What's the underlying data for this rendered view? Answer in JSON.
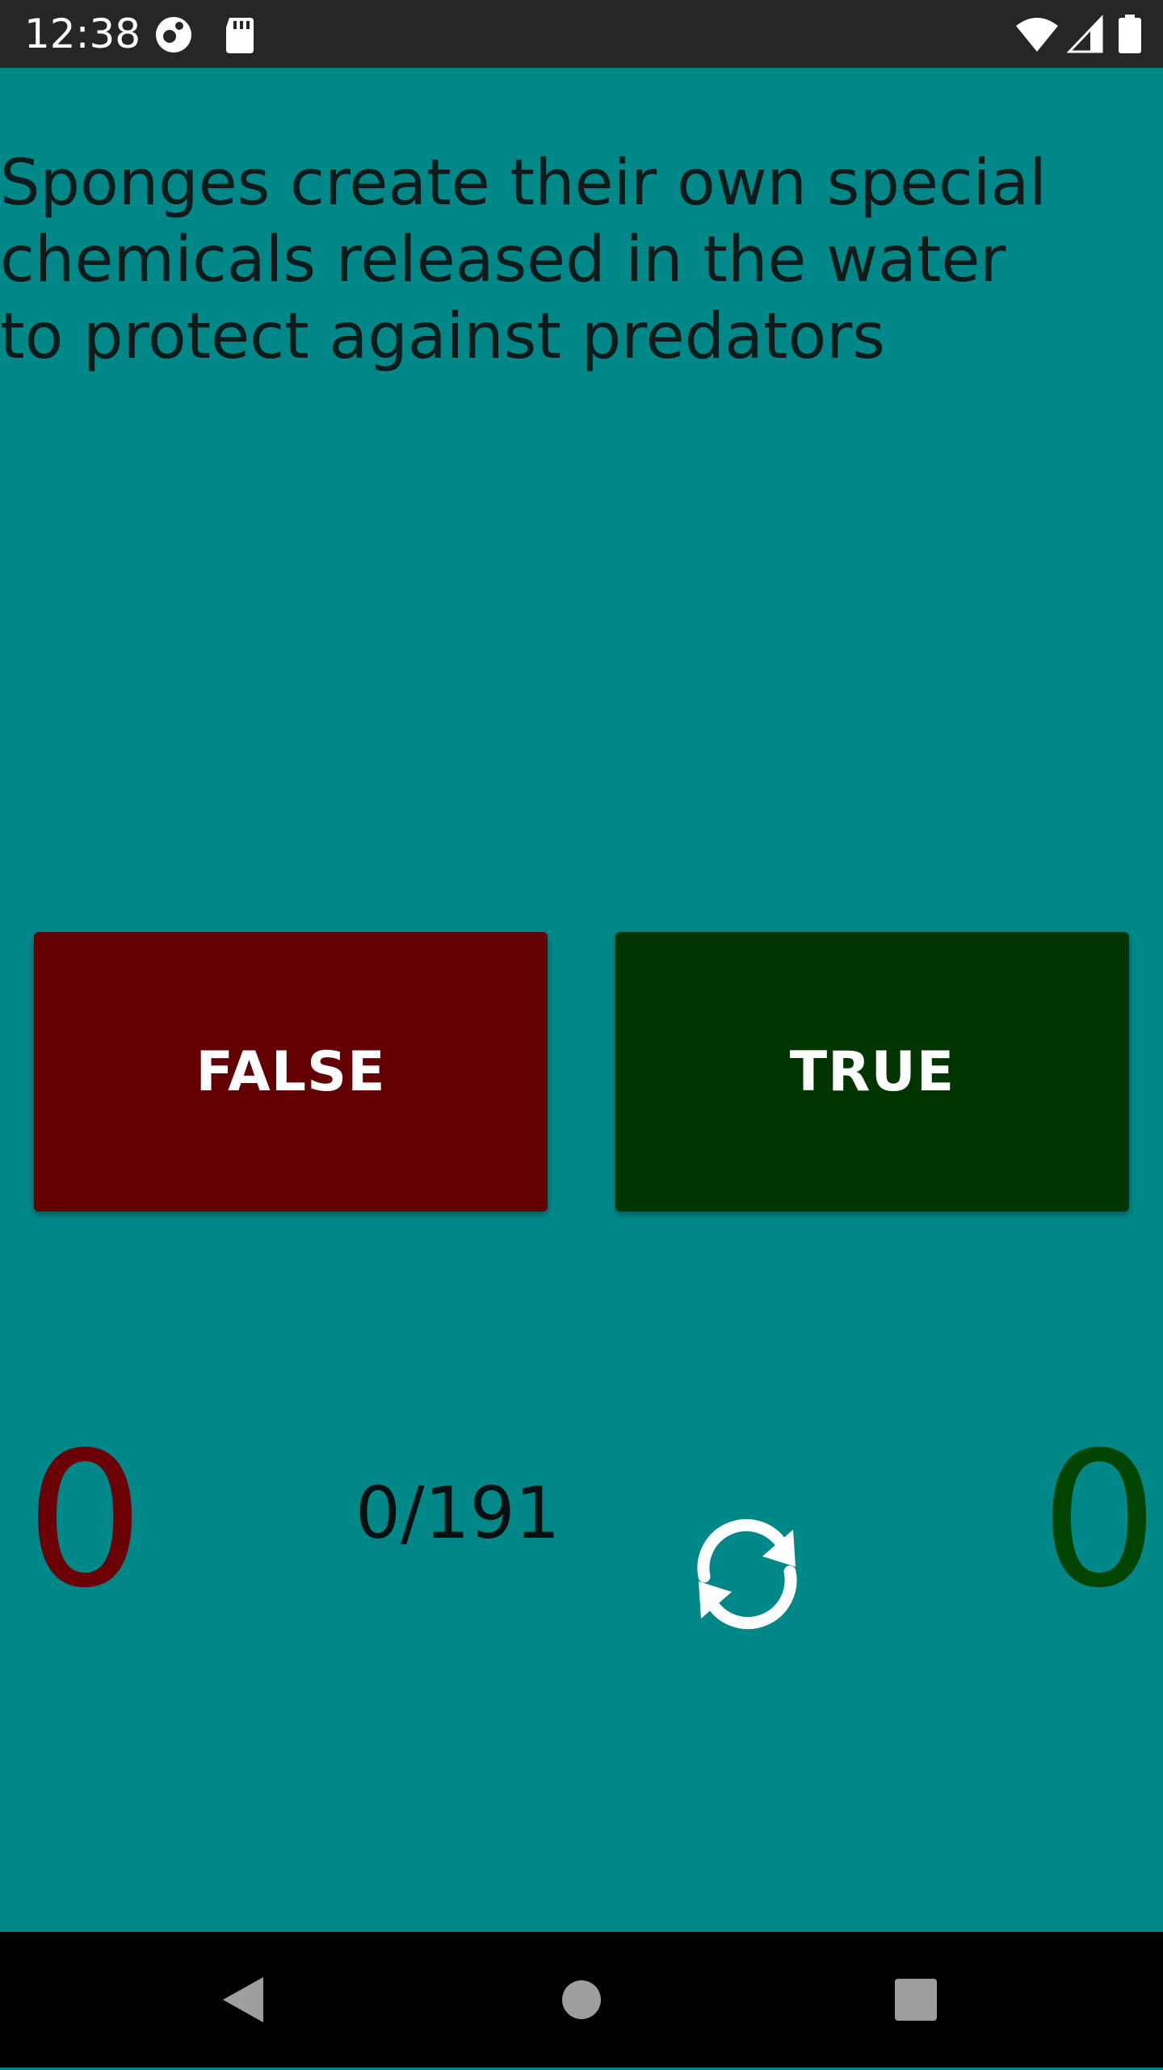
{
  "status_bar": {
    "time": "12:38",
    "icons": [
      "app-notification-icon",
      "sd-card-icon",
      "wifi-icon",
      "cellular-signal-icon",
      "battery-icon"
    ]
  },
  "quiz": {
    "question": "Sponges create their own special chemicals released in the water to protect against predators",
    "false_label": "FALSE",
    "true_label": "TRUE",
    "false_score": "0",
    "true_score": "0",
    "progress": "0/191",
    "refresh_icon": "refresh-icon"
  },
  "nav_bar": {
    "icons": [
      "back-icon",
      "home-icon",
      "recents-icon"
    ]
  },
  "colors": {
    "background": "#008888",
    "false_button": "#630004",
    "true_button": "#003500",
    "false_score": "#6b0007",
    "true_score": "#004400",
    "status_bar": "#262626",
    "nav_bar": "#000000"
  }
}
